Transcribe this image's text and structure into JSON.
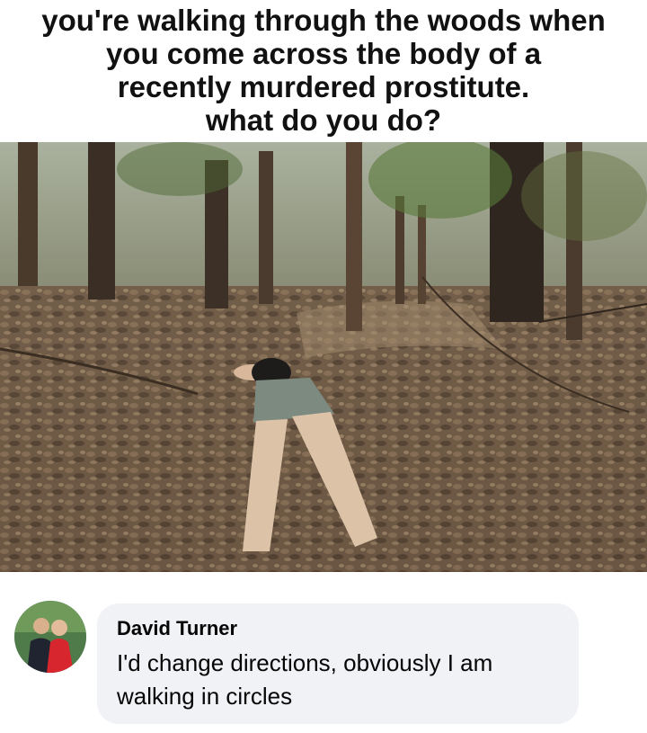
{
  "caption": {
    "lines": [
      "you're walking through the woods when",
      "you come across the body of a",
      "recently murdered prostitute.",
      "what do you do?"
    ]
  },
  "photo": {
    "icon": "forest-scene-photo"
  },
  "comment": {
    "author": "David Turner",
    "text": "I'd change directions, obviously I am walking in circles",
    "avatar_icon": "profile-photo-avatar"
  },
  "colors": {
    "bubble": "#f0f2f5",
    "text": "#050505",
    "leaves": "#7a6249",
    "trees": "#3d3026"
  }
}
